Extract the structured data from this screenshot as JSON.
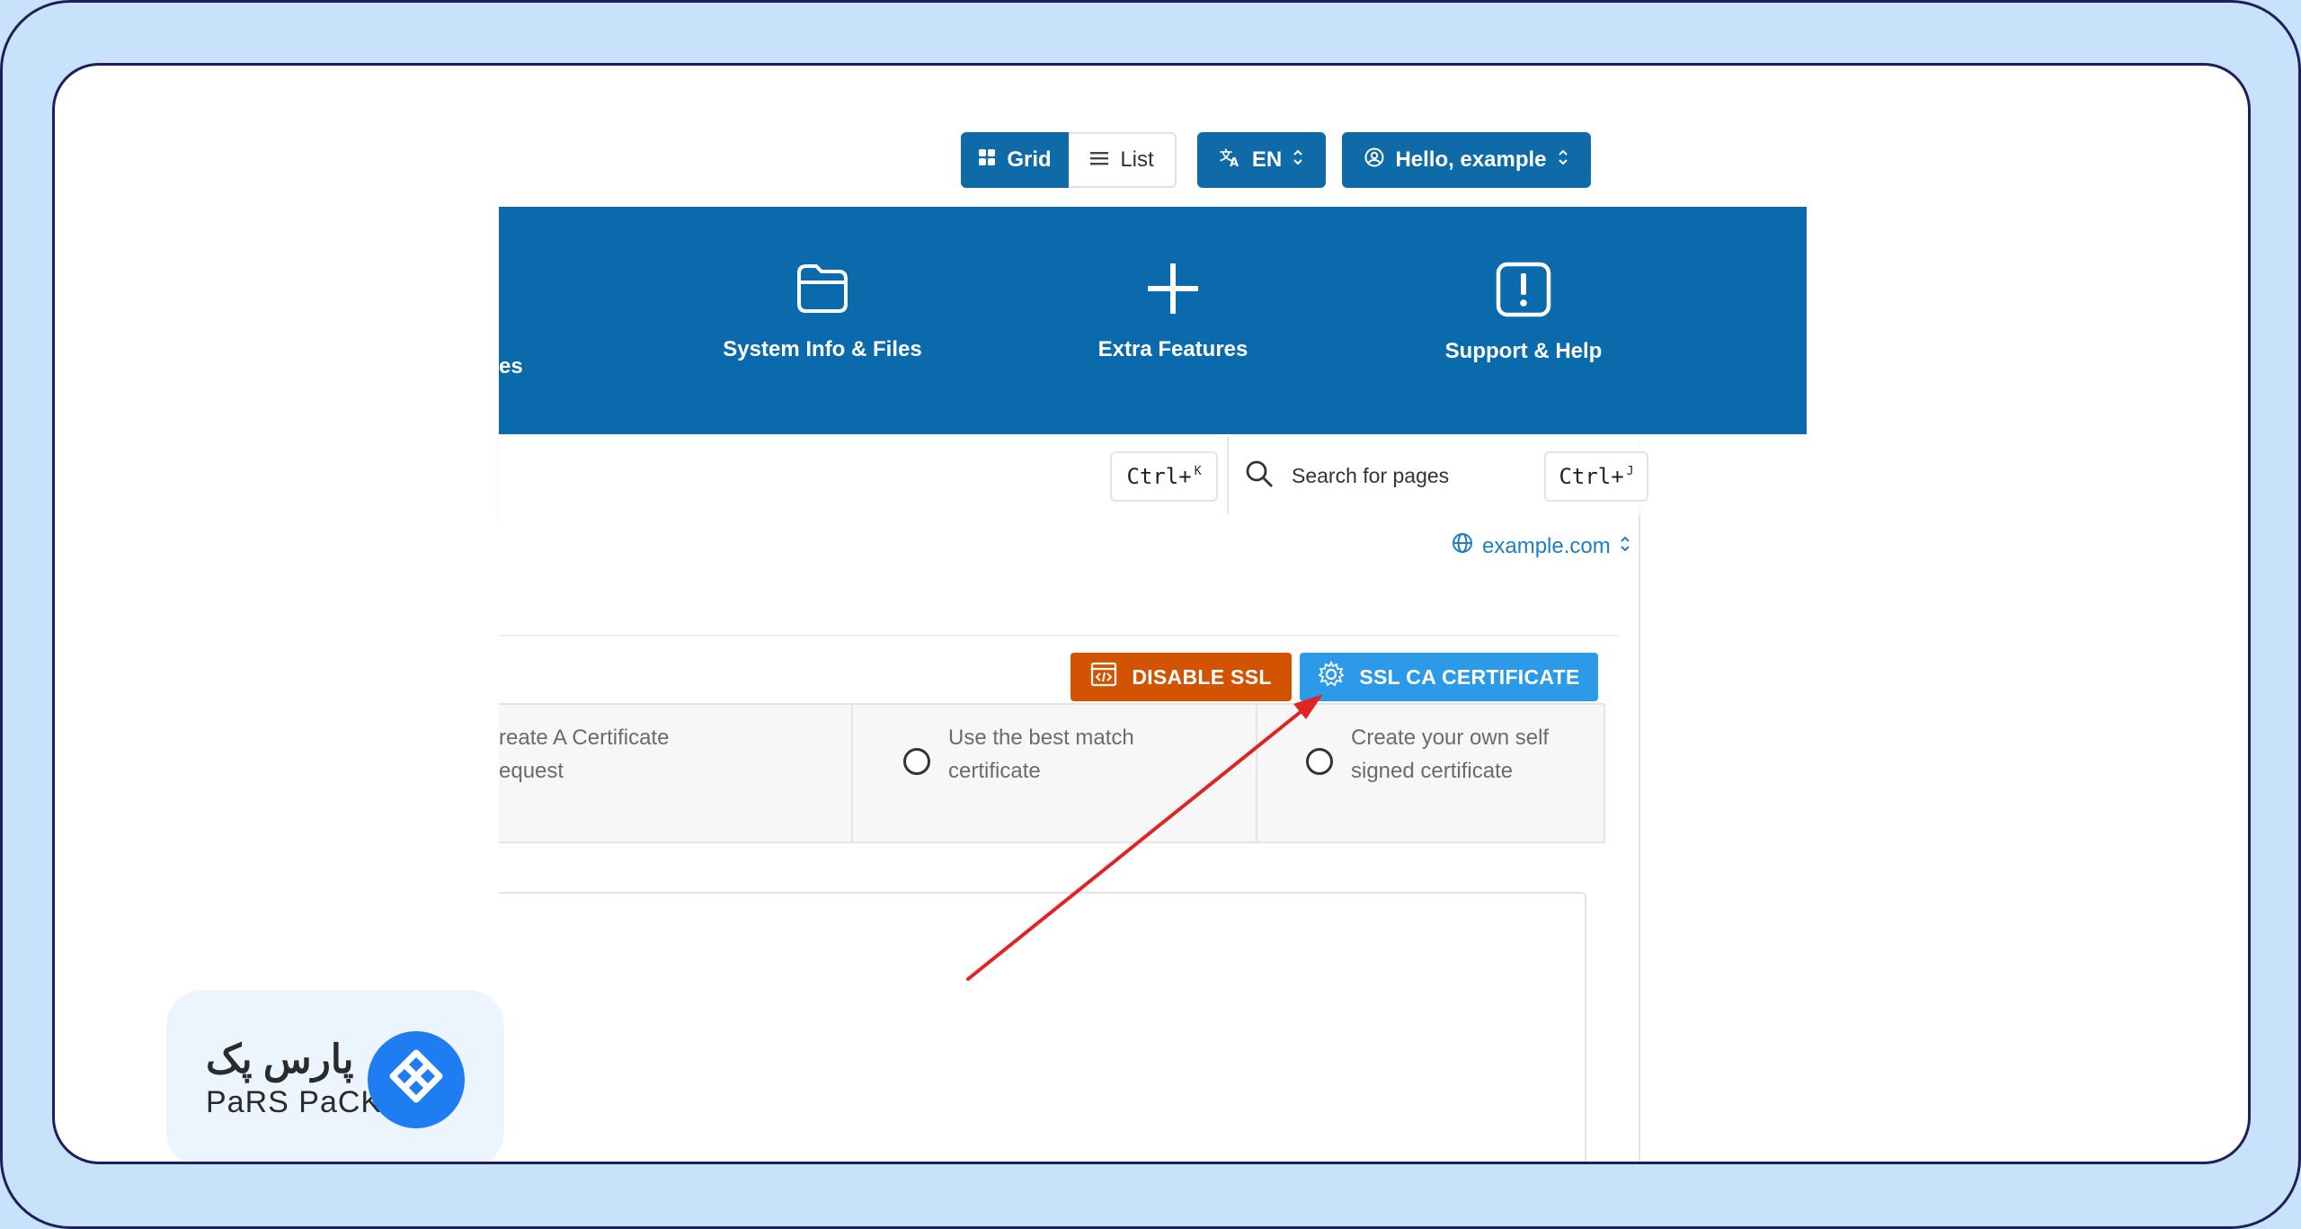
{
  "toolbar": {
    "grid_label": "Grid",
    "list_label": "List",
    "language_label": "EN",
    "user_label": "Hello, example"
  },
  "nav": {
    "partial_label": "es",
    "items": [
      {
        "label": "System Info & Files",
        "icon": "folder-icon"
      },
      {
        "label": "Extra Features",
        "icon": "plus-icon"
      },
      {
        "label": "Support & Help",
        "icon": "alert-icon"
      }
    ]
  },
  "search": {
    "shortcut_left": "Ctrl+",
    "shortcut_left_key": "K",
    "placeholder": "Search for pages",
    "shortcut_right": "Ctrl+",
    "shortcut_right_key": "J"
  },
  "domain": {
    "label": "example.com"
  },
  "actions": {
    "disable_ssl": "DISABLE SSL",
    "ssl_ca_certificate": "SSL CA CERTIFICATE"
  },
  "options": [
    {
      "line1": "reate A Certificate",
      "line2": "equest"
    },
    {
      "line1": "Use the best match",
      "line2": "certificate"
    },
    {
      "line1": "Create your own self",
      "line2": "signed certificate"
    }
  ],
  "logo": {
    "text_fa": "پارس پک",
    "text_en": "PaRS PaCK"
  },
  "colors": {
    "nav_blue": "#0b6aab",
    "disable_orange": "#d35400",
    "ssl_blue": "#2d9ae8",
    "arrow_red": "#e02424",
    "brand_blue": "#1e7df0"
  }
}
